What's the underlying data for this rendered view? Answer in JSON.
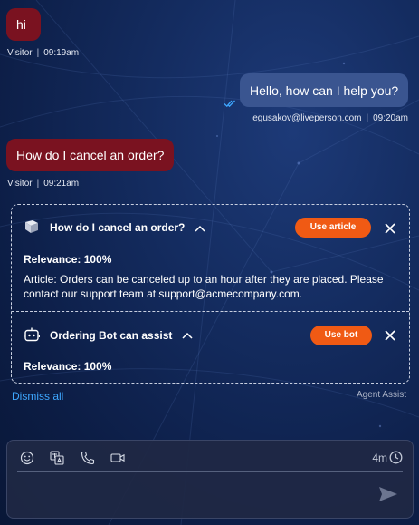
{
  "messages": [
    {
      "text": "hi",
      "sender": "Visitor",
      "time": "09:19am"
    },
    {
      "text": "Hello, how can I help you?",
      "sender": "egusakov@liveperson.com",
      "time": "09:20am"
    },
    {
      "text": "How do I cancel an order?",
      "sender": "Visitor",
      "time": "09:21am"
    }
  ],
  "agent_assist": {
    "article_card": {
      "title": "How do I cancel an order?",
      "button_label": "Use article",
      "relevance": "Relevance: 100%",
      "body": "Article: Orders can be canceled up to an hour after they are placed. Please contact our support team at support@acmecompany.com."
    },
    "bot_card": {
      "title": "Ordering Bot can assist",
      "button_label": "Use bot",
      "relevance": "Relevance: 100%"
    },
    "dismiss_label": "Dismiss all",
    "footer_label": "Agent Assist"
  },
  "composer": {
    "timer": "4m"
  },
  "colors": {
    "visitor_bubble": "#7a1220",
    "agent_bubble": "#3a5590",
    "accent_button": "#f05a14",
    "link": "#3ea7ff"
  },
  "icons": [
    "double-check-icon",
    "book-icon",
    "robot-icon",
    "chevron-up-icon",
    "close-icon",
    "emoji-icon",
    "translate-icon",
    "phone-icon",
    "video-icon",
    "clock-icon",
    "send-icon"
  ]
}
